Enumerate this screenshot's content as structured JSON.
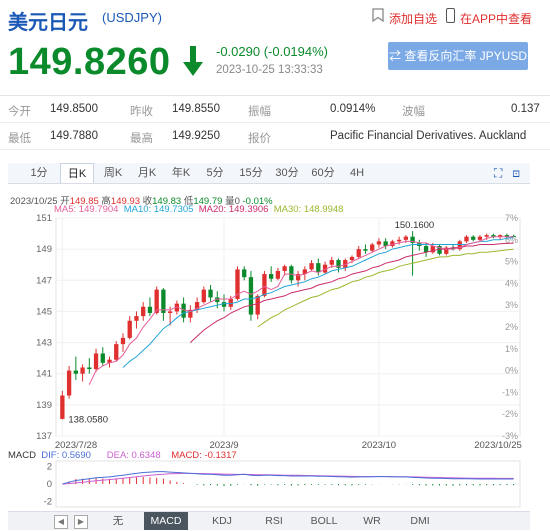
{
  "header": {
    "title": "美元日元",
    "code": "(USDJPY)",
    "add_watch": "添加自选",
    "app_view": "在APP中查看"
  },
  "quote": {
    "price": "149.8260",
    "change": "-0.0290 (-0.0194%)",
    "timestamp": "2023-10-25 13:33:33",
    "reverse_button": "查看反向汇率 JPYUSD",
    "direction": "down",
    "down_color": "#0a8a2b"
  },
  "stats": {
    "row1": [
      {
        "label": "今开",
        "value": "149.8500"
      },
      {
        "label": "昨收",
        "value": "149.8550"
      },
      {
        "label": "振幅",
        "value": "0.0914%"
      },
      {
        "label": "波幅",
        "value": "0.137"
      }
    ],
    "row2": [
      {
        "label": "最低",
        "value": "149.7880"
      },
      {
        "label": "最高",
        "value": "149.9250"
      },
      {
        "label": "报价",
        "value": "Pacific Financial Derivatives. Auckland"
      }
    ]
  },
  "tabs": [
    "1分",
    "日K",
    "周K",
    "月K",
    "年K",
    "5分",
    "15分",
    "30分",
    "60分",
    "4H"
  ],
  "active_tab": "日K",
  "chart_info": {
    "date": "2023/10/25",
    "open_l": "开",
    "open": "149.85",
    "high_l": "高",
    "high": "149.93",
    "close_l": "收",
    "close": "149.83",
    "low_l": "低",
    "low": "149.79",
    "vol_l": "量",
    "vol": "0",
    "pct": "-0.01%"
  },
  "ma": {
    "ma5": "MA5: 149.7904",
    "ma10": "MA10: 149.7305",
    "ma20": "MA20: 149.3906",
    "ma30": "MA30: 148.9948"
  },
  "macd": {
    "label": "MACD",
    "dif": "DIF: 0.5690",
    "dea": "DEA: 0.6348",
    "macd": "MACD: -0.1317"
  },
  "bottom_tabs": [
    "无",
    "MACD",
    "KDJ",
    "RSI",
    "BOLL",
    "WR",
    "DMI"
  ],
  "active_bottom_tab": "MACD",
  "chart_data": {
    "type": "candlestick",
    "y_ticks_left": [
      "151",
      "149",
      "147",
      "145",
      "143",
      "141",
      "139",
      "137"
    ],
    "y_ticks_right": [
      "7%",
      "6%",
      "5%",
      "4%",
      "3%",
      "2%",
      "1%",
      "0%",
      "-1%",
      "-2%",
      "-3%"
    ],
    "x_ticks": [
      "2023/7/28",
      "2023/9",
      "2023/10",
      "2023/10/25"
    ],
    "ylim": [
      137,
      151
    ],
    "max_label": "150.1600",
    "min_label": "138.0580",
    "macd_y_ticks": [
      "2",
      "0",
      "-2"
    ],
    "ohlc": [
      [
        138.1,
        139.9,
        138.058,
        139.6
      ],
      [
        139.6,
        141.5,
        139.4,
        141.2
      ],
      [
        141.2,
        142.1,
        140.6,
        141.0
      ],
      [
        141.0,
        141.6,
        140.5,
        141.4
      ],
      [
        141.4,
        142.0,
        141.0,
        141.3
      ],
      [
        141.3,
        142.6,
        141.1,
        142.3
      ],
      [
        142.3,
        142.7,
        141.5,
        141.7
      ],
      [
        141.7,
        142.1,
        141.4,
        141.9
      ],
      [
        141.9,
        143.1,
        141.8,
        142.9
      ],
      [
        142.9,
        143.6,
        142.4,
        143.3
      ],
      [
        143.3,
        144.7,
        143.2,
        144.4
      ],
      [
        144.4,
        145.0,
        143.9,
        144.7
      ],
      [
        144.7,
        145.6,
        144.4,
        145.3
      ],
      [
        145.3,
        145.9,
        144.7,
        144.9
      ],
      [
        144.9,
        146.6,
        144.8,
        146.4
      ],
      [
        146.4,
        146.5,
        144.4,
        144.9
      ],
      [
        144.9,
        145.3,
        144.1,
        145.0
      ],
      [
        145.0,
        145.7,
        144.8,
        145.5
      ],
      [
        145.5,
        145.9,
        144.3,
        144.6
      ],
      [
        144.6,
        145.4,
        144.3,
        145.1
      ],
      [
        145.1,
        145.9,
        144.9,
        145.6
      ],
      [
        145.6,
        146.6,
        145.5,
        146.4
      ],
      [
        146.4,
        146.7,
        145.6,
        145.9
      ],
      [
        145.9,
        146.3,
        145.2,
        145.6
      ],
      [
        145.6,
        146.1,
        145.0,
        145.3
      ],
      [
        145.3,
        146.0,
        145.1,
        145.8
      ],
      [
        145.8,
        147.9,
        145.7,
        147.7
      ],
      [
        147.7,
        147.9,
        147.0,
        147.2
      ],
      [
        147.2,
        147.6,
        144.4,
        144.8
      ],
      [
        144.8,
        146.1,
        144.5,
        146.0
      ],
      [
        146.0,
        147.6,
        145.9,
        147.4
      ],
      [
        147.4,
        147.9,
        146.9,
        147.1
      ],
      [
        147.1,
        147.8,
        147.0,
        147.6
      ],
      [
        147.6,
        148.0,
        147.3,
        147.9
      ],
      [
        147.9,
        148.0,
        146.8,
        147.0
      ],
      [
        147.0,
        147.6,
        146.6,
        147.4
      ],
      [
        147.4,
        147.9,
        147.0,
        147.7
      ],
      [
        147.7,
        148.3,
        147.6,
        148.1
      ],
      [
        148.1,
        148.4,
        147.3,
        147.5
      ],
      [
        147.5,
        148.2,
        147.4,
        148.0
      ],
      [
        148.0,
        148.5,
        147.8,
        148.3
      ],
      [
        148.3,
        148.4,
        147.5,
        147.8
      ],
      [
        147.8,
        148.4,
        147.6,
        148.3
      ],
      [
        148.3,
        148.6,
        148.1,
        148.5
      ],
      [
        148.5,
        149.2,
        148.4,
        149.0
      ],
      [
        149.0,
        149.3,
        148.7,
        148.9
      ],
      [
        148.9,
        149.4,
        148.8,
        149.3
      ],
      [
        149.3,
        149.7,
        149.1,
        149.5
      ],
      [
        149.5,
        149.7,
        149.0,
        149.2
      ],
      [
        149.2,
        149.6,
        149.1,
        149.5
      ],
      [
        149.5,
        149.8,
        149.3,
        149.6
      ],
      [
        149.6,
        149.9,
        149.4,
        149.8
      ],
      [
        149.8,
        150.16,
        147.3,
        149.4
      ],
      [
        149.4,
        149.6,
        148.9,
        149.2
      ],
      [
        149.2,
        149.4,
        148.5,
        148.8
      ],
      [
        148.8,
        149.4,
        148.7,
        149.2
      ],
      [
        149.2,
        149.3,
        148.6,
        148.7
      ],
      [
        148.7,
        149.2,
        148.6,
        149.1
      ],
      [
        149.1,
        149.3,
        148.9,
        149.0
      ],
      [
        149.0,
        149.6,
        148.9,
        149.5
      ],
      [
        149.5,
        149.9,
        149.4,
        149.8
      ],
      [
        149.8,
        149.9,
        149.5,
        149.6
      ],
      [
        149.6,
        149.9,
        149.5,
        149.8
      ],
      [
        149.8,
        150.0,
        149.6,
        149.9
      ],
      [
        149.9,
        150.0,
        149.7,
        149.8
      ],
      [
        149.8,
        149.95,
        149.6,
        149.9
      ],
      [
        149.9,
        150.0,
        149.7,
        149.8
      ],
      [
        149.85,
        149.93,
        149.79,
        149.83
      ]
    ],
    "ma5": [
      null,
      null,
      null,
      null,
      140.3,
      141.2,
      141.5,
      141.7,
      141.8,
      142.2,
      142.9,
      143.3,
      144.0,
      144.5,
      145.1,
      145.1,
      145.1,
      145.3,
      145.1,
      145.0,
      145.2,
      145.4,
      145.6,
      145.8,
      145.8,
      145.8,
      146.1,
      146.3,
      146.1,
      146.3,
      146.6,
      146.4,
      146.6,
      147.4,
      147.4,
      147.3,
      147.4,
      147.6,
      147.5,
      147.7,
      147.9,
      147.9,
      148.0,
      148.2,
      148.4,
      148.6,
      148.8,
      149.0,
      149.2,
      149.3,
      149.4,
      149.5,
      149.5,
      149.4,
      149.4,
      149.2,
      149.1,
      149.0,
      149.0,
      149.1,
      149.3,
      149.4,
      149.5,
      149.7,
      149.8,
      149.8,
      149.8,
      149.79
    ],
    "ma10": [
      null,
      null,
      null,
      null,
      null,
      null,
      null,
      null,
      null,
      141.4,
      141.8,
      142.1,
      142.5,
      142.9,
      143.4,
      143.9,
      144.2,
      144.6,
      144.9,
      145.0,
      145.1,
      145.2,
      145.3,
      145.4,
      145.5,
      145.5,
      145.6,
      145.8,
      145.8,
      145.9,
      146.1,
      146.2,
      146.4,
      146.6,
      146.7,
      146.8,
      146.9,
      147.1,
      147.2,
      147.4,
      147.6,
      147.7,
      147.8,
      147.9,
      148.1,
      148.3,
      148.5,
      148.7,
      148.8,
      149.0,
      149.1,
      149.2,
      149.3,
      149.3,
      149.3,
      149.3,
      149.3,
      149.3,
      149.3,
      149.3,
      149.3,
      149.4,
      149.5,
      149.5,
      149.6,
      149.6,
      149.7,
      149.73
    ],
    "ma20": [
      null,
      null,
      null,
      null,
      null,
      null,
      null,
      null,
      null,
      null,
      null,
      null,
      null,
      null,
      null,
      null,
      null,
      null,
      null,
      143.0,
      143.4,
      143.8,
      144.1,
      144.4,
      144.6,
      144.9,
      145.1,
      145.3,
      145.4,
      145.5,
      145.7,
      145.8,
      145.9,
      146.0,
      146.2,
      146.3,
      146.4,
      146.5,
      146.7,
      146.8,
      146.9,
      147.1,
      147.2,
      147.4,
      147.5,
      147.6,
      147.8,
      147.9,
      148.1,
      148.2,
      148.3,
      148.5,
      148.6,
      148.7,
      148.8,
      148.9,
      149.0,
      149.0,
      149.1,
      149.1,
      149.2,
      149.2,
      149.3,
      149.3,
      149.3,
      149.35,
      149.37,
      149.39
    ],
    "ma30": [
      null,
      null,
      null,
      null,
      null,
      null,
      null,
      null,
      null,
      null,
      null,
      null,
      null,
      null,
      null,
      null,
      null,
      null,
      null,
      null,
      null,
      null,
      null,
      null,
      null,
      null,
      null,
      null,
      null,
      144.0,
      144.3,
      144.6,
      144.8,
      145.1,
      145.3,
      145.5,
      145.7,
      145.9,
      146.0,
      146.2,
      146.4,
      146.5,
      146.7,
      146.9,
      147.0,
      147.2,
      147.3,
      147.5,
      147.6,
      147.7,
      147.9,
      148.0,
      148.1,
      148.2,
      148.3,
      148.4,
      148.5,
      148.5,
      148.6,
      148.6,
      148.7,
      148.7,
      148.8,
      148.8,
      148.85,
      148.9,
      148.95,
      148.99
    ],
    "macd_dif": [
      0,
      0.2,
      0.4,
      0.5,
      0.6,
      0.7,
      0.75,
      0.8,
      0.9,
      1.0,
      1.1,
      1.2,
      1.3,
      1.35,
      1.4,
      1.4,
      1.35,
      1.3,
      1.25,
      1.2,
      1.15,
      1.1,
      1.1,
      1.05,
      1.0,
      1.0,
      1.05,
      1.1,
      1.0,
      0.95,
      1.0,
      1.0,
      0.95,
      0.95,
      0.9,
      0.9,
      0.9,
      0.9,
      0.88,
      0.88,
      0.85,
      0.82,
      0.8,
      0.78,
      0.8,
      0.8,
      0.82,
      0.85,
      0.84,
      0.82,
      0.8,
      0.8,
      0.75,
      0.72,
      0.68,
      0.66,
      0.64,
      0.62,
      0.6,
      0.6,
      0.6,
      0.58,
      0.57,
      0.57,
      0.57,
      0.57,
      0.57,
      0.569
    ],
    "macd_dea": [
      0,
      0.05,
      0.12,
      0.2,
      0.28,
      0.36,
      0.44,
      0.5,
      0.58,
      0.66,
      0.74,
      0.82,
      0.9,
      0.98,
      1.05,
      1.1,
      1.15,
      1.18,
      1.2,
      1.2,
      1.19,
      1.18,
      1.16,
      1.14,
      1.12,
      1.1,
      1.09,
      1.09,
      1.07,
      1.05,
      1.04,
      1.03,
      1.02,
      1.0,
      0.99,
      0.98,
      0.96,
      0.95,
      0.93,
      0.92,
      0.9,
      0.89,
      0.87,
      0.86,
      0.85,
      0.84,
      0.84,
      0.84,
      0.84,
      0.83,
      0.82,
      0.81,
      0.8,
      0.79,
      0.77,
      0.75,
      0.73,
      0.71,
      0.7,
      0.68,
      0.67,
      0.66,
      0.65,
      0.64,
      0.64,
      0.635,
      0.635,
      0.6348
    ]
  },
  "colors": {
    "up": "#e02f2f",
    "down": "#0a8a2b",
    "ma5": "#e45f9c",
    "ma10": "#22a5d8",
    "ma20": "#cc2c6b",
    "ma30": "#9ab82d",
    "dif": "#4a6fd8",
    "dea": "#cc5fd0"
  }
}
